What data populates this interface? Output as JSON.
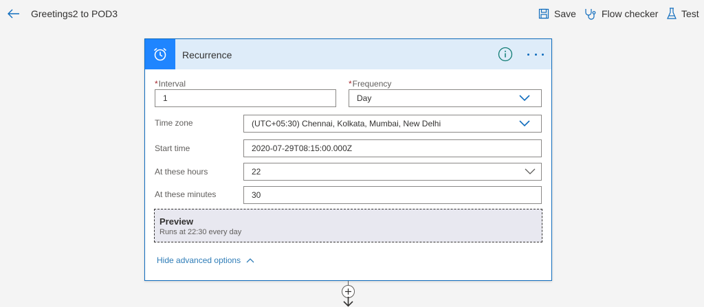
{
  "header": {
    "title": "Greetings2 to POD3",
    "save_label": "Save",
    "flow_checker_label": "Flow checker",
    "test_label": "Test"
  },
  "card": {
    "title": "Recurrence",
    "icons": {
      "trigger": "alarm-clock-icon",
      "info": "info-icon",
      "more": "more-options-icon"
    },
    "interval": {
      "label": "Interval",
      "required_mark": "*",
      "value": "1"
    },
    "frequency": {
      "label": "Frequency",
      "required_mark": "*",
      "value": "Day"
    },
    "time_zone": {
      "label": "Time zone",
      "value": "(UTC+05:30) Chennai, Kolkata, Mumbai, New Delhi"
    },
    "start_time": {
      "label": "Start time",
      "value": "2020-07-29T08:15:00.000Z"
    },
    "hours": {
      "label": "At these hours",
      "value": "22"
    },
    "minutes": {
      "label": "At these minutes",
      "value": "30"
    },
    "preview": {
      "title": "Preview",
      "text": "Runs at 22:30 every day"
    },
    "advanced_link": "Hide advanced options"
  },
  "colors": {
    "accent": "#0f6cbd",
    "header_bg": "#deecf9",
    "trigger_bg": "#1f85ff",
    "link": "#2e7cb7"
  }
}
